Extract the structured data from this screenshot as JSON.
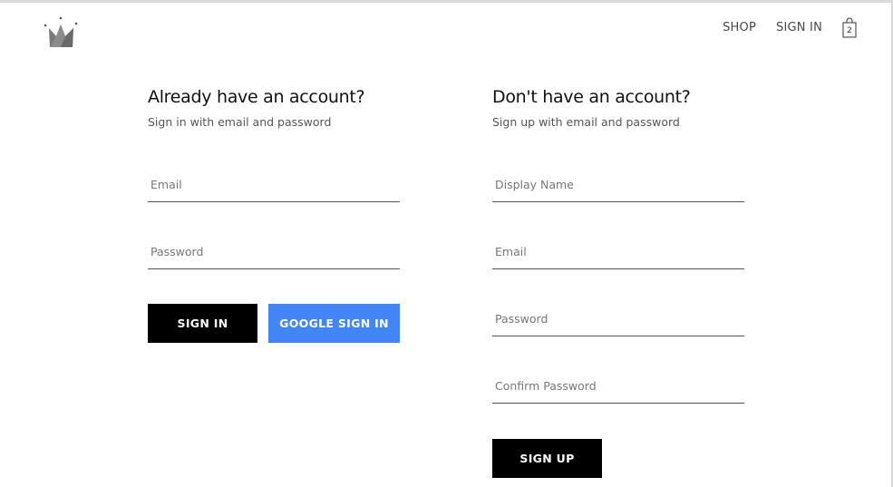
{
  "nav": {
    "items": [
      {
        "label": "SHOP"
      },
      {
        "label": "SIGN IN"
      }
    ],
    "cart_count": "2",
    "cart_icon": "shopping-bag-icon",
    "logo_icon": "crown-icon"
  },
  "signin": {
    "title": "Already have an account?",
    "subtitle": "Sign in with email and password",
    "email_placeholder": "Email",
    "password_placeholder": "Password",
    "signin_label": "SIGN IN",
    "google_label": "GOOGLE SIGN IN"
  },
  "signup": {
    "title": "Don't have an account?",
    "subtitle": "Sign up with email and password",
    "display_name_placeholder": "Display Name",
    "email_placeholder": "Email",
    "password_placeholder": "Password",
    "confirm_password_placeholder": "Confirm Password",
    "signup_label": "SIGN UP"
  },
  "colors": {
    "google_blue": "#4285f4",
    "primary_black": "#000000"
  }
}
